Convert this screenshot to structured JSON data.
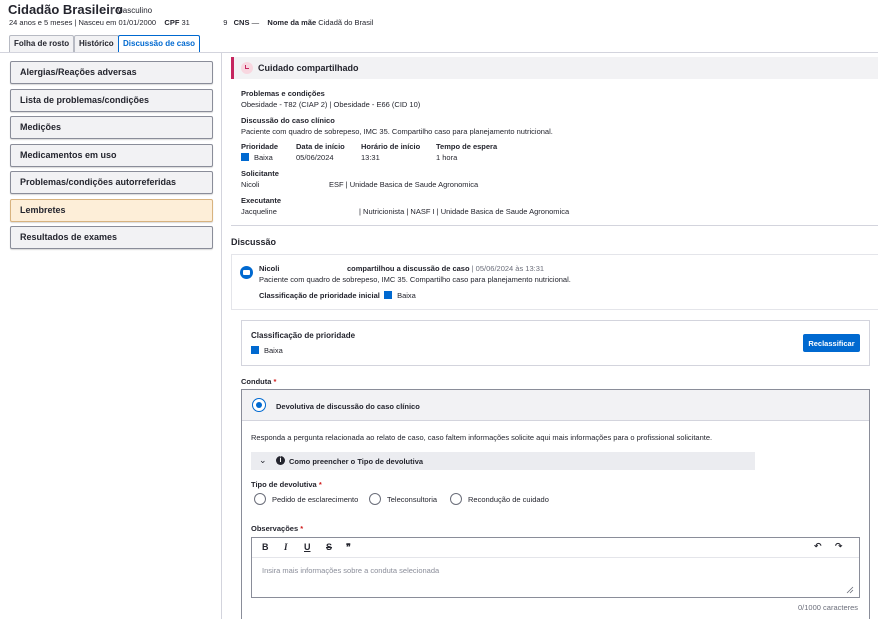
{
  "header": {
    "name": "Cidadão Brasileiro",
    "sex": "Masculino",
    "age": "24 anos e 5 meses",
    "birth": "Nasceu em 01/01/2000",
    "cpf_label": "CPF",
    "cpf_value": "31",
    "cpf_tail": "9",
    "cns_label": "CNS",
    "cns_value": "—",
    "mother_label": "Nome da mãe",
    "mother_value": "Cidadã do Brasil"
  },
  "tabs": [
    "Folha de rosto",
    "Histórico",
    "Discussão de caso"
  ],
  "sidebar": {
    "items": [
      "Alergias/Reações adversas",
      "Lista de problemas/condições",
      "Medições",
      "Medicamentos em uso",
      "Problemas/condições autorreferidas",
      "Lembretes",
      "Resultados de exames"
    ]
  },
  "case": {
    "title": "Cuidado compartilhado",
    "problems_label": "Problemas e condições",
    "problems_value": "Obesidade - T82 (CIAP 2) | Obesidade - E66 (CID 10)",
    "discussion_label": "Discussão do caso clínico",
    "discussion_value": "Paciente com quadro de sobrepeso, IMC 35. Compartilho caso para planejamento nutricional.",
    "priority_label": "Prioridade",
    "priority_value": "Baixa",
    "start_date_label": "Data de início",
    "start_date_value": "05/06/2024",
    "start_time_label": "Horário de início",
    "start_time_value": "13:31",
    "wait_label": "Tempo de espera",
    "wait_value": "1 hora",
    "requester_label": "Solicitante",
    "requester_name": "Nicoli",
    "requester_unit": "ESF | Unidade Basica de Saude Agronomica",
    "executor_label": "Executante",
    "executor_name": "Jacqueline",
    "executor_unit": "| Nutricionista | NASF I | Unidade Basica de Saude Agronomica"
  },
  "discussion": {
    "title": "Discussão",
    "author": "Nicoli",
    "action": "compartilhou a discussão de caso",
    "when": "| 05/06/2024 às 13:31",
    "text": "Paciente com quadro de sobrepeso, IMC 35. Compartilho caso para planejamento nutricional.",
    "initial_priority_label": "Classificação de prioridade inicial",
    "initial_priority_value": "Baixa"
  },
  "priority_box": {
    "label": "Classificação de prioridade",
    "value": "Baixa",
    "button": "Reclassificar"
  },
  "conduta": {
    "label": "Conduta",
    "required": "*",
    "option": "Devolutiva de discussão do caso clínico",
    "hint": "Responda a pergunta relacionada ao relato de caso, caso faltem informações solicite aqui mais informações para o profissional solicitante.",
    "howto": "Como preencher o Tipo de devolutiva",
    "type_label": "Tipo de devolutiva",
    "types": [
      "Pedido de esclarecimento",
      "Teleconsultoria",
      "Recondução de cuidado"
    ],
    "obs_label": "Observações",
    "placeholder": "Insira mais informações sobre a conduta selecionada",
    "counter": "0/1000 caracteres"
  },
  "colors": {
    "accent": "#0069d0",
    "highlight_bg": "#fdeed8",
    "case_accent": "#c5265f",
    "required": "#d01c1c"
  }
}
